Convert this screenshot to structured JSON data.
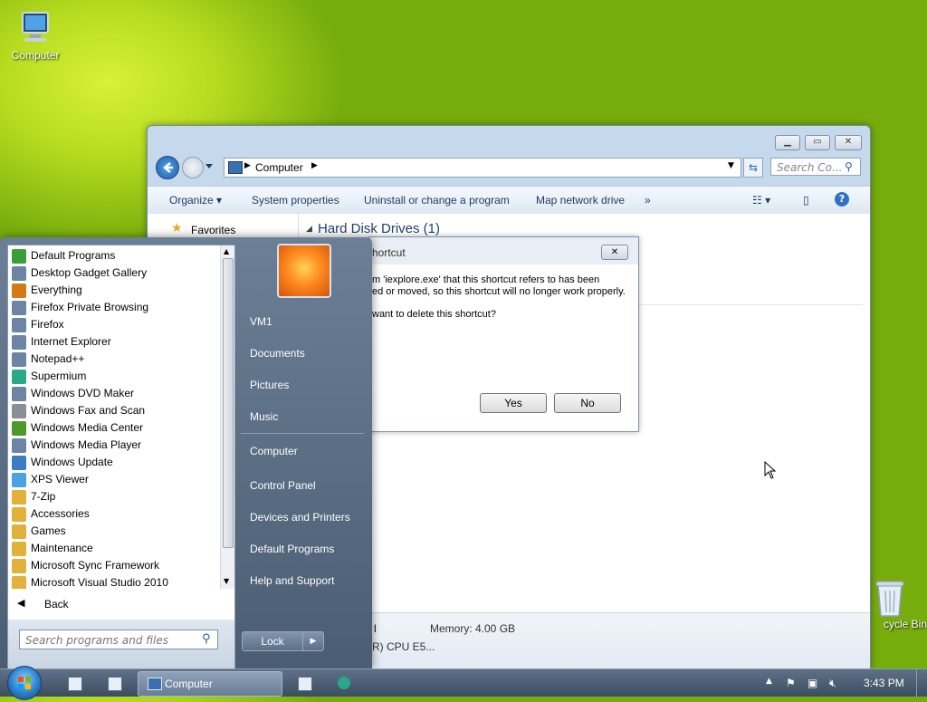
{
  "desktop": {
    "icons": [
      {
        "label": "Computer"
      },
      {
        "label": "cycle Bin"
      }
    ]
  },
  "explorer": {
    "address": {
      "crumb": "Computer"
    },
    "search_placeholder": "Search Co...",
    "toolbar": {
      "organize": "Organize",
      "system_properties": "System properties",
      "uninstall": "Uninstall or change a program",
      "map_drive": "Map network drive",
      "more": "»"
    },
    "nav": {
      "favorites": "Favorites"
    },
    "section_title": "Hard Disk Drives (1)",
    "details": {
      "memory": "Memory: 4.00 GB",
      "cpu_fragment": "R) CPU E5...",
      "fragment_l": "l"
    }
  },
  "dialog": {
    "title": "hortcut",
    "message_line1": "m 'iexplore.exe' that this shortcut refers to has been",
    "message_line2": "ed or moved, so this shortcut will no longer work properly.",
    "question": "want to delete this shortcut?",
    "yes": "Yes",
    "no": "No"
  },
  "start_menu": {
    "programs": [
      {
        "label": "Default Programs",
        "icon": "default-programs-icon",
        "color": "#3a9e3a"
      },
      {
        "label": "Desktop Gadget Gallery",
        "icon": "gadget-icon",
        "color": "#6d84a5"
      },
      {
        "label": "Everything",
        "icon": "magnifier-icon",
        "color": "#d47a12"
      },
      {
        "label": "Firefox Private Browsing",
        "icon": "app-icon",
        "color": "#6d84a5"
      },
      {
        "label": "Firefox",
        "icon": "app-icon",
        "color": "#6d84a5"
      },
      {
        "label": "Internet Explorer",
        "icon": "app-icon",
        "color": "#6d84a5"
      },
      {
        "label": "Notepad++",
        "icon": "app-icon",
        "color": "#6d84a5"
      },
      {
        "label": "Supermium",
        "icon": "supermium-icon",
        "color": "#2aa88a"
      },
      {
        "label": "Windows DVD Maker",
        "icon": "app-icon",
        "color": "#6d84a5"
      },
      {
        "label": "Windows Fax and Scan",
        "icon": "fax-icon",
        "color": "#8a8f96"
      },
      {
        "label": "Windows Media Center",
        "icon": "media-center-icon",
        "color": "#4c9a2a"
      },
      {
        "label": "Windows Media Player",
        "icon": "app-icon",
        "color": "#6d84a5"
      },
      {
        "label": "Windows Update",
        "icon": "update-icon",
        "color": "#3c7cc4"
      },
      {
        "label": "XPS Viewer",
        "icon": "xps-icon",
        "color": "#4aa3df"
      },
      {
        "label": "7-Zip",
        "icon": "folder-icon",
        "color": "#e2b13c"
      },
      {
        "label": "Accessories",
        "icon": "folder-icon",
        "color": "#e2b13c"
      },
      {
        "label": "Games",
        "icon": "folder-icon",
        "color": "#e2b13c"
      },
      {
        "label": "Maintenance",
        "icon": "folder-icon",
        "color": "#e2b13c"
      },
      {
        "label": "Microsoft Sync Framework",
        "icon": "folder-icon",
        "color": "#e2b13c"
      },
      {
        "label": "Microsoft Visual Studio 2010",
        "icon": "folder-icon",
        "color": "#e2b13c"
      }
    ],
    "back": "Back",
    "search_placeholder": "Search programs and files",
    "right_items": [
      "VM1",
      "Documents",
      "Pictures",
      "Music",
      "Computer",
      "Control Panel",
      "Devices and Printers",
      "Default Programs",
      "Help and Support"
    ],
    "lock": "Lock"
  },
  "taskbar": {
    "active_window": "Computer",
    "clock": "3:43 PM"
  }
}
